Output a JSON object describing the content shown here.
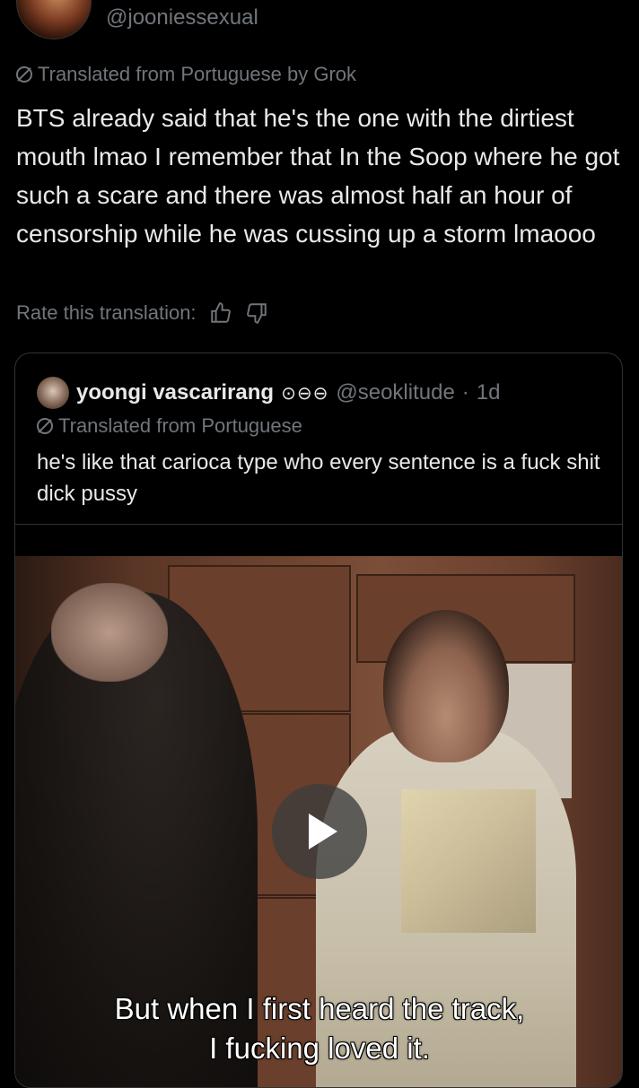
{
  "post": {
    "handle": "@jooniessexual",
    "translated_label": "Translated from Portuguese by Grok",
    "text": "BTS already said that he's the one with the dirtiest mouth lmao I remember that In the Soop where he got such a scare and there was almost half an hour of censorship while he was cussing up a storm lmaooo",
    "rate_label": "Rate this translation:"
  },
  "quote": {
    "name": "yoongi vascarirang",
    "emoji": "⊙⊖⊖",
    "handle": "@seoklitude",
    "separator": "·",
    "time": "1d",
    "translated_label": "Translated from Portuguese",
    "text": "he's like that carioca type who every sentence is a fuck shit dick pussy",
    "video": {
      "subtitle_line1": "But when I first heard the track,",
      "subtitle_line2": "I fucking loved it."
    }
  },
  "icons": {
    "translate": "translate-slash-icon",
    "thumbs_up": "thumbs-up-icon",
    "thumbs_down": "thumbs-down-icon",
    "play": "play-icon"
  }
}
